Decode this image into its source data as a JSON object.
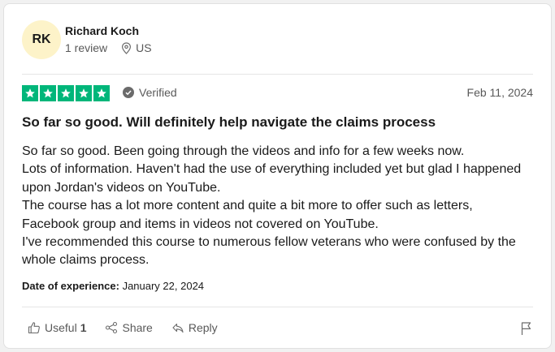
{
  "reviewer": {
    "initials": "RK",
    "name": "Richard Koch",
    "review_count": "1 review",
    "country": "US"
  },
  "rating": {
    "stars": 5,
    "color": "#00b67a"
  },
  "verified_label": "Verified",
  "review_date": "Feb 11, 2024",
  "review": {
    "title": "So far so good. Will definitely help navigate the claims process",
    "lines": [
      "So far so good. Been going through the videos and info for a few weeks now.",
      "Lots of information. Haven't had the use of everything included yet but glad I happened upon Jordan's videos on YouTube.",
      "The course has a lot more content and quite a bit more to offer such as letters, Facebook group and items in videos not covered on YouTube.",
      "I've recommended this course to numerous fellow veterans who were confused by the whole claims process."
    ]
  },
  "experience": {
    "label": "Date of experience:",
    "date": "January 22, 2024"
  },
  "actions": {
    "useful_label": "Useful",
    "useful_count": "1",
    "share_label": "Share",
    "reply_label": "Reply"
  },
  "icons": {
    "location": "location-pin-icon",
    "verified": "check-circle-icon",
    "useful": "thumbs-up-icon",
    "share": "share-icon",
    "reply": "reply-arrow-icon",
    "report": "flag-icon"
  }
}
